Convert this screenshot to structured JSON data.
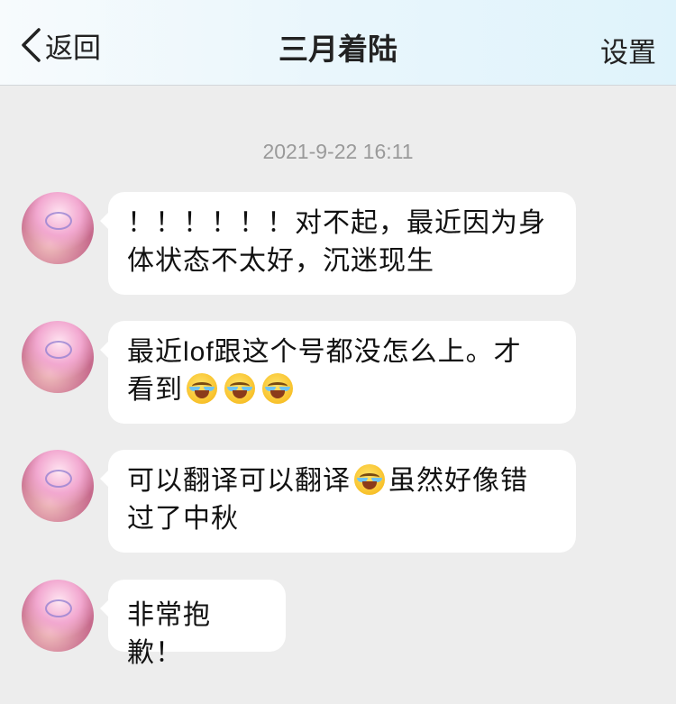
{
  "nav": {
    "back_label": "返回",
    "title": "三月着陆",
    "settings_label": "设置"
  },
  "timestamp": "2021-9-22 16:11",
  "messages": [
    {
      "lines": [
        "！！！！！！对不起，最近因为身",
        "体状态不太好，沉迷现生"
      ]
    },
    {
      "line1": "最近lof跟这个号都没怎么上。才",
      "line2": "看到",
      "emoji_count": 3
    },
    {
      "line1_a": "可以翻译可以翻译",
      "line1_b": "虽然好像错",
      "line2": "过了中秋"
    },
    {
      "text": "非常抱歉！"
    }
  ],
  "icons": {
    "back": "chevron-left-icon",
    "emoji": "laughing-crying-emoji-icon"
  },
  "colors": {
    "background": "#ededed",
    "bubble": "#ffffff",
    "timestamp": "#9a9a9a",
    "text": "#111111"
  }
}
